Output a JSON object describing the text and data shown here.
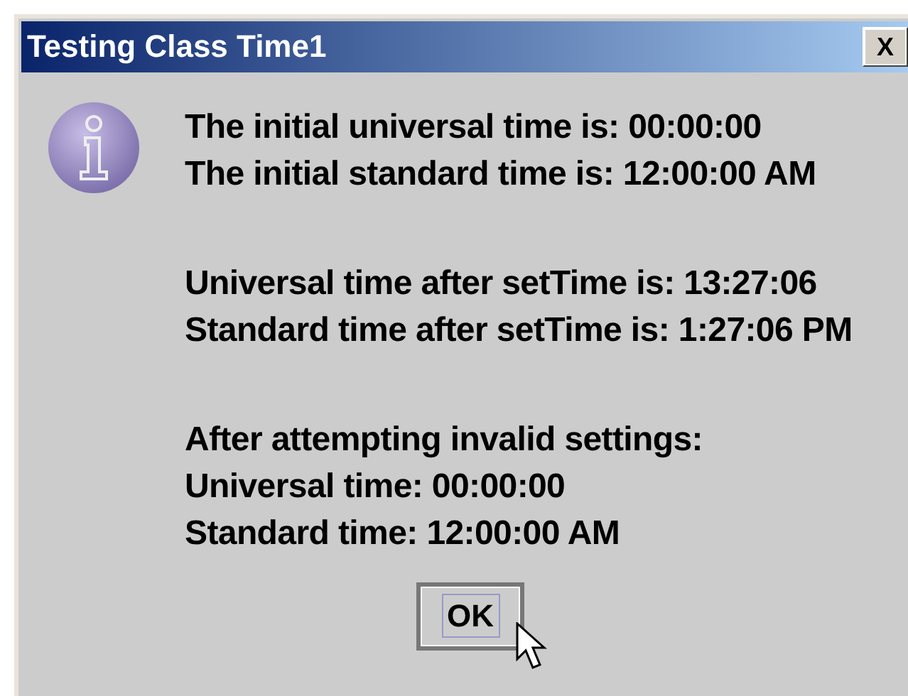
{
  "window": {
    "title": "Testing Class Time1",
    "close_button": "X"
  },
  "message_groups": [
    [
      "The initial universal time is: 00:00:00",
      "The initial standard time is: 12:00:00 AM"
    ],
    [
      "Universal time after setTime is: 13:27:06",
      "Standard time after setTime is: 1:27:06 PM"
    ],
    [
      "After attempting invalid settings:",
      "Universal time: 00:00:00",
      "Standard time: 12:00:00 AM"
    ]
  ],
  "buttons": [
    {
      "label": "OK",
      "focused": true
    }
  ]
}
